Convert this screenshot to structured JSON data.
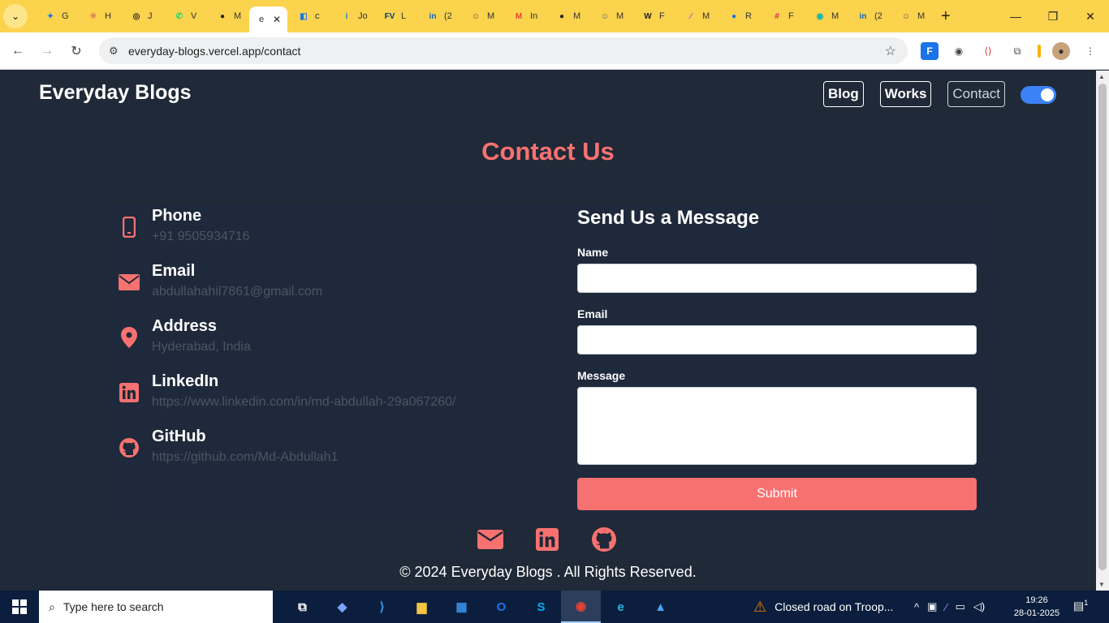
{
  "browser": {
    "tabs": [
      {
        "label": "G",
        "fav": "✦",
        "color": "#1a73e8"
      },
      {
        "label": "H",
        "fav": "✳",
        "color": "#d97757"
      },
      {
        "label": "J",
        "fav": "◎",
        "color": "#222222"
      },
      {
        "label": "V",
        "fav": "✆",
        "color": "#25d366"
      },
      {
        "label": "M",
        "fav": "●",
        "color": "#222222"
      },
      {
        "label": "e",
        "fav": "",
        "color": "#ffffff",
        "active": true
      },
      {
        "label": "c",
        "fav": "◧",
        "color": "#1a73e8"
      },
      {
        "label": "Jo",
        "fav": "i",
        "color": "#1a73e8"
      },
      {
        "label": "L",
        "fav": "FV",
        "color": "#0b3b7a"
      },
      {
        "label": "(2",
        "fav": "in",
        "color": "#0a66c2"
      },
      {
        "label": "M",
        "fav": "☺",
        "color": "#555555"
      },
      {
        "label": "In",
        "fav": "M",
        "color": "#ea4335"
      },
      {
        "label": "M",
        "fav": "●",
        "color": "#222222"
      },
      {
        "label": "M",
        "fav": "☺",
        "color": "#555555"
      },
      {
        "label": "F",
        "fav": "W",
        "color": "#222222"
      },
      {
        "label": "M",
        "fav": "∕",
        "color": "#a142f4"
      },
      {
        "label": "R",
        "fav": "●",
        "color": "#1a73e8"
      },
      {
        "label": "F",
        "fav": "#",
        "color": "#e01e5a"
      },
      {
        "label": "M",
        "fav": "◉",
        "color": "#00b3b3"
      },
      {
        "label": "(2",
        "fav": "in",
        "color": "#0a66c2"
      },
      {
        "label": "M",
        "fav": "☺",
        "color": "#555555"
      }
    ],
    "url": "everyday-blogs.vercel.app/contact"
  },
  "site": {
    "brand": "Everyday Blogs",
    "nav": [
      "Blog",
      "Works",
      "Contact"
    ],
    "title": "Contact Us",
    "contacts": [
      {
        "label": "Phone",
        "value": "+91 9505934716",
        "icon": "phone-icon"
      },
      {
        "label": "Email",
        "value": "abdullahahil7861@gmail.com",
        "icon": "envelope-icon"
      },
      {
        "label": "Address",
        "value": "Hyderabad, India",
        "icon": "map-pin-icon"
      },
      {
        "label": "LinkedIn",
        "value": "https://www.linkedin.com/in/md-abdullah-29a067260/",
        "icon": "linkedin-icon"
      },
      {
        "label": "GitHub",
        "value": "https://github.com/Md-Abdullah1",
        "icon": "github-icon"
      }
    ],
    "form": {
      "title": "Send Us a Message",
      "name_label": "Name",
      "email_label": "Email",
      "message_label": "Message",
      "submit": "Submit"
    },
    "copyright": "© 2024 Everyday Blogs . All Rights Reserved.",
    "accent": "#f87171"
  },
  "taskbar": {
    "search_placeholder": "Type here to search",
    "news": "Closed road on Troop...",
    "time": "19:26",
    "date": "28-01-2025",
    "notifications": "1"
  }
}
